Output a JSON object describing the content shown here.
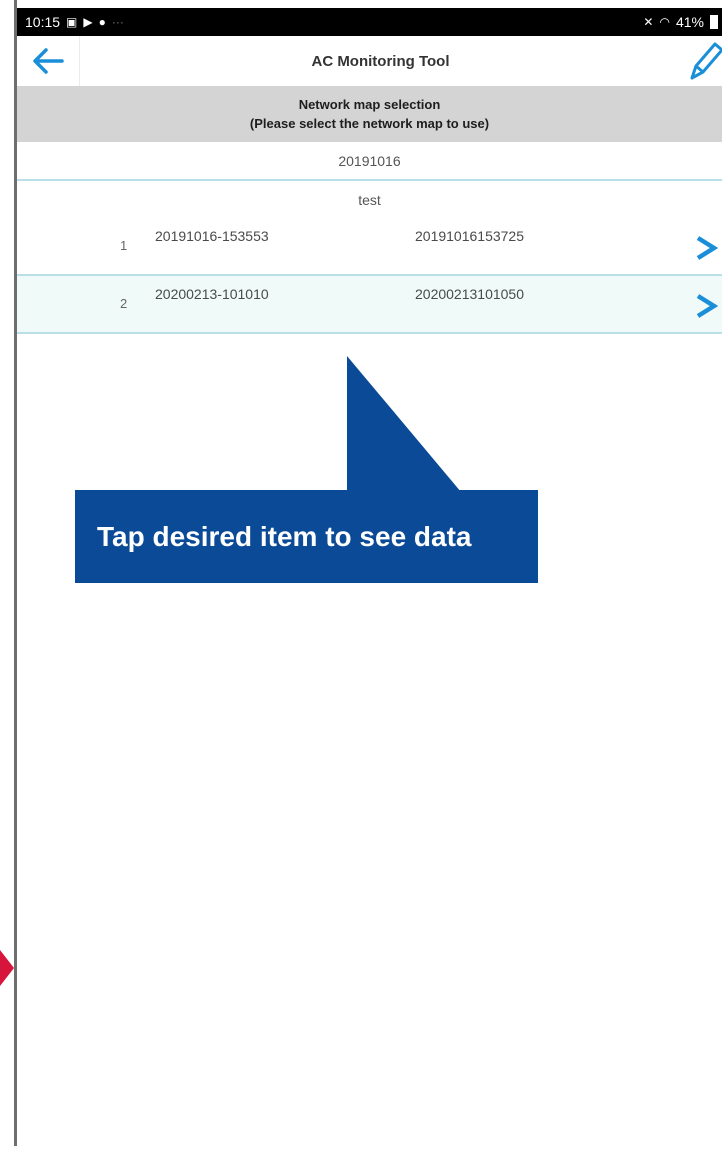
{
  "status_bar": {
    "time": "10:15",
    "battery": "41%",
    "left_icons": [
      "gallery-icon",
      "play-icon",
      "notification-icon",
      "more-icon"
    ],
    "right_icons": [
      "mute-icon",
      "wifi-icon",
      "battery-icon"
    ]
  },
  "app_bar": {
    "title": "AC Monitoring Tool",
    "back_icon": "arrow-left-icon",
    "edit_icon": "pencil-icon"
  },
  "section_header": {
    "title": "Network map selection",
    "subtitle": "(Please select the network map to use)"
  },
  "groups": [
    "20191016",
    "test"
  ],
  "maps": [
    {
      "index": "1",
      "name": "20191016-153553",
      "timestamp": "20191016153725"
    },
    {
      "index": "2",
      "name": "20200213-101010",
      "timestamp": "20200213101050"
    }
  ],
  "callout": {
    "text": "Tap desired item to see data"
  },
  "colors": {
    "accent": "#1a8fd8",
    "callout_bg": "#0b4a96",
    "header_bg": "#d4d4d4",
    "row_divider": "#b9dfe9",
    "alt_row_bg": "#f0faf9",
    "pointer_red": "#d7143c"
  }
}
